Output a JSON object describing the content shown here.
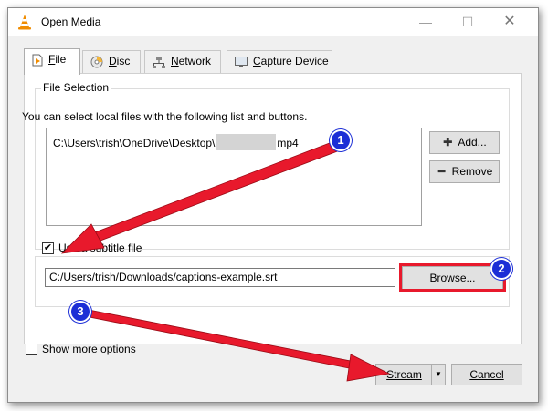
{
  "window": {
    "title": "Open Media",
    "controls": {
      "minimize": "—",
      "maximize": "☐",
      "close": "✕"
    }
  },
  "tabs": [
    {
      "label": "File",
      "icon": "file-icon",
      "active": true
    },
    {
      "label": "Disc",
      "icon": "disc-icon",
      "active": false
    },
    {
      "label": "Network",
      "icon": "network-icon",
      "active": false
    },
    {
      "label": "Capture Device",
      "icon": "capture-device-icon",
      "active": false
    }
  ],
  "file_selection": {
    "legend": "File Selection",
    "description": "You can select local files with the following list and buttons.",
    "file_path_prefix": "C:\\Users\\trish\\OneDrive\\Desktop\\",
    "file_path_suffix": "mp4",
    "add_label": "Add...",
    "remove_label": "Remove"
  },
  "subtitle": {
    "checkbox_label": "Use a subtitle file",
    "checked": true,
    "path": "C:/Users/trish/Downloads/captions-example.srt",
    "browse_label": "Browse..."
  },
  "options": {
    "show_more_label": "Show more options",
    "checked": false
  },
  "footer": {
    "stream_label": "Stream",
    "stream_dropdown": "▼",
    "cancel_label": "Cancel"
  },
  "annotations": {
    "step_1": "1",
    "step_2": "2",
    "step_3": "3",
    "arrow_color": "#e8192c",
    "badge_color": "#1c2ed6"
  }
}
